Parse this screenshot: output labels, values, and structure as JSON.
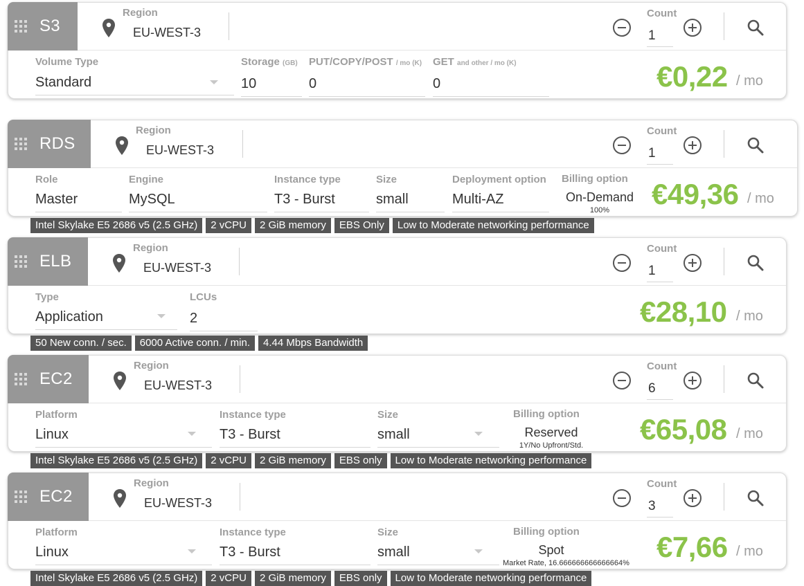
{
  "labels": {
    "region": "Region",
    "count": "Count",
    "per_month": "/ mo"
  },
  "cards": {
    "s3": {
      "service": "S3",
      "region": "EU-WEST-3",
      "count": "1",
      "volume_type_label": "Volume Type",
      "volume_type": "Standard",
      "storage_label": "Storage",
      "storage_unit": "(GB)",
      "storage": "10",
      "put_label": "PUT/COPY/POST",
      "put_unit": "/ mo (K)",
      "put": "0",
      "get_label": "GET",
      "get_unit": "and other / mo (K)",
      "get": "0",
      "price": "€0,22"
    },
    "rds": {
      "service": "RDS",
      "region": "EU-WEST-3",
      "count": "1",
      "role_label": "Role",
      "role": "Master",
      "engine_label": "Engine",
      "engine": "MySQL",
      "instance_label": "Instance type",
      "instance": "T3 - Burst",
      "size_label": "Size",
      "size": "small",
      "deploy_label": "Deployment option",
      "deploy": "Multi-AZ",
      "billing_label": "Billing option",
      "billing": "On-Demand",
      "billing_sub": "100%",
      "price": "€49,36",
      "specs": [
        "Intel Skylake E5 2686 v5 (2.5 GHz)",
        "2 vCPU",
        "2 GiB memory",
        "EBS Only",
        "Low to Moderate networking performance"
      ]
    },
    "elb": {
      "service": "ELB",
      "region": "EU-WEST-3",
      "count": "1",
      "type_label": "Type",
      "type": "Application",
      "lcu_label": "LCUs",
      "lcu": "2",
      "price": "€28,10",
      "specs": [
        "50 New conn. / sec.",
        "6000 Active conn. / min.",
        "4.44 Mbps Bandwidth"
      ]
    },
    "ec2a": {
      "service": "EC2",
      "region": "EU-WEST-3",
      "count": "6",
      "platform_label": "Platform",
      "platform": "Linux",
      "instance_label": "Instance type",
      "instance": "T3 - Burst",
      "size_label": "Size",
      "size": "small",
      "billing_label": "Billing option",
      "billing": "Reserved",
      "billing_sub": "1Y/No Upfront/Std.",
      "price": "€65,08",
      "specs": [
        "Intel Skylake E5 2686 v5 (2.5 GHz)",
        "2 vCPU",
        "2 GiB memory",
        "EBS only",
        "Low to Moderate networking performance"
      ]
    },
    "ec2b": {
      "service": "EC2",
      "region": "EU-WEST-3",
      "count": "3",
      "platform_label": "Platform",
      "platform": "Linux",
      "instance_label": "Instance type",
      "instance": "T3 - Burst",
      "size_label": "Size",
      "size": "small",
      "billing_label": "Billing option",
      "billing": "Spot",
      "billing_sub": "Market Rate, 16.666666666666664%",
      "price": "€7,66",
      "specs": [
        "Intel Skylake E5 2686 v5 (2.5 GHz)",
        "2 vCPU",
        "2 GiB memory",
        "EBS only",
        "Low to Moderate networking performance"
      ]
    }
  },
  "colors": {
    "price": "#8bc34a",
    "service_tab": "#979797",
    "spec_badge": "#555555"
  },
  "icons": [
    "drag-handle-icon",
    "location-pin-icon",
    "minus-circle-icon",
    "plus-circle-icon",
    "search-icon",
    "dropdown-caret-icon"
  ]
}
